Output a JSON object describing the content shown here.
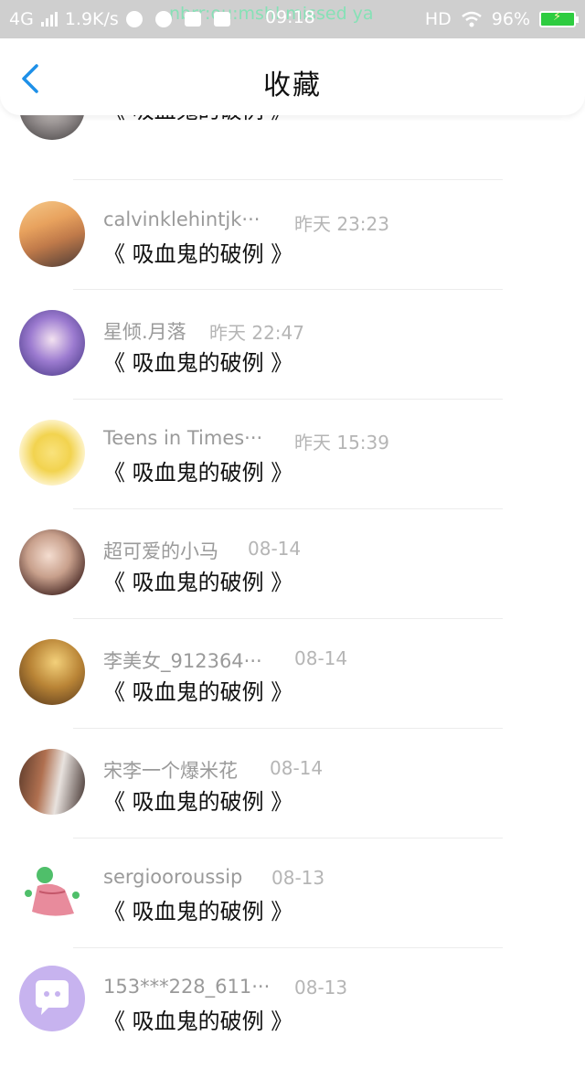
{
  "status_bar": {
    "network": "4G",
    "speed": "1.9K/s",
    "ticker": "nbrr:ou:mshl missed ya",
    "time": "09:18",
    "hd": "HD",
    "battery": "96%"
  },
  "header": {
    "title": "收藏",
    "back_icon": "chevron-left-icon"
  },
  "colors": {
    "accent": "#1e90e8",
    "battery": "#2ecc40",
    "status_bar": "#cfcfcf"
  },
  "items": [
    {
      "name": "",
      "time": "",
      "content": "《 吸血鬼的破例 》"
    },
    {
      "name": "calvinklehintjk···",
      "time": "昨天 23:23",
      "content": "《 吸血鬼的破例 》"
    },
    {
      "name": "星倾.月落",
      "time": "昨天 22:47",
      "content": "《 吸血鬼的破例 》"
    },
    {
      "name": "Teens in Times···",
      "time": "昨天 15:39",
      "content": "《 吸血鬼的破例 》"
    },
    {
      "name": "超可爱的小马",
      "time": "08-14",
      "content": "《 吸血鬼的破例 》"
    },
    {
      "name": "李美女_912364···",
      "time": "08-14",
      "content": "《 吸血鬼的破例 》"
    },
    {
      "name": "宋李一个爆米花",
      "time": "08-14",
      "content": "《 吸血鬼的破例 》"
    },
    {
      "name": "sergiooroussip",
      "time": "08-13",
      "content": "《 吸血鬼的破例 》"
    },
    {
      "name": "153***228_611···",
      "time": "08-13",
      "content": "《 吸血鬼的破例 》"
    }
  ]
}
